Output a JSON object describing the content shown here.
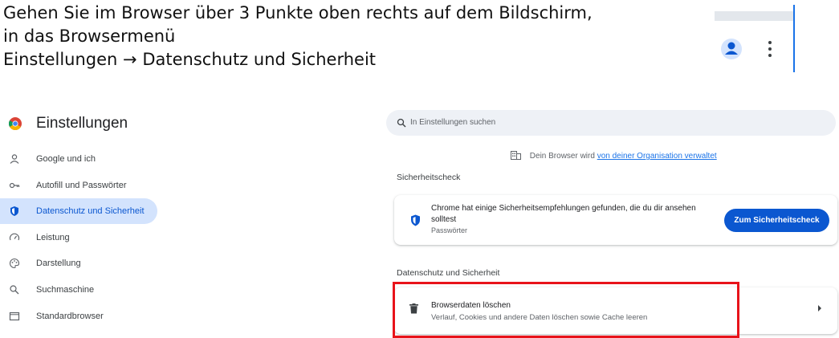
{
  "instructions": {
    "line1": "Gehen Sie im Browser über 3 Punkte oben rechts auf dem Bildschirm,",
    "line2": "in das Browsermenü",
    "line3_start": "Einstellungen",
    "line3_arrow": "→",
    "line3_end": "Datenschutz und Sicherheit"
  },
  "toolbar": {
    "icons": [
      "profile-icon",
      "three-dots-menu-icon"
    ]
  },
  "settings": {
    "title": "Einstellungen",
    "sidebar": {
      "items": [
        {
          "label": "Google und ich",
          "icon": "person-icon"
        },
        {
          "label": "Autofill und Passwörter",
          "icon": "key-icon"
        },
        {
          "label": "Datenschutz und Sicherheit",
          "icon": "shield-icon",
          "active": true
        },
        {
          "label": "Leistung",
          "icon": "speedometer-icon"
        },
        {
          "label": "Darstellung",
          "icon": "palette-icon"
        },
        {
          "label": "Suchmaschine",
          "icon": "search-icon"
        },
        {
          "label": "Standardbrowser",
          "icon": "browser-window-icon"
        }
      ]
    },
    "search": {
      "placeholder": "In Einstellungen suchen"
    },
    "org_notice": {
      "text": "Dein Browser wird",
      "link": "von deiner Organisation verwaltet"
    },
    "safety_check": {
      "section_title": "Sicherheitscheck",
      "message": "Chrome hat einige Sicherheitsempfehlungen gefunden, die du dir ansehen solltest",
      "sub": "Passwörter",
      "button": "Zum Sicherheitscheck"
    },
    "privacy": {
      "section_title": "Datenschutz und Sicherheit",
      "clear_title": "Browserdaten löschen",
      "clear_desc": "Verlauf, Cookies und andere Daten löschen sowie Cache leeren"
    }
  },
  "colors": {
    "accent": "#0b57d0",
    "highlight": "#e8131a",
    "active_bg": "#d3e3fd"
  }
}
